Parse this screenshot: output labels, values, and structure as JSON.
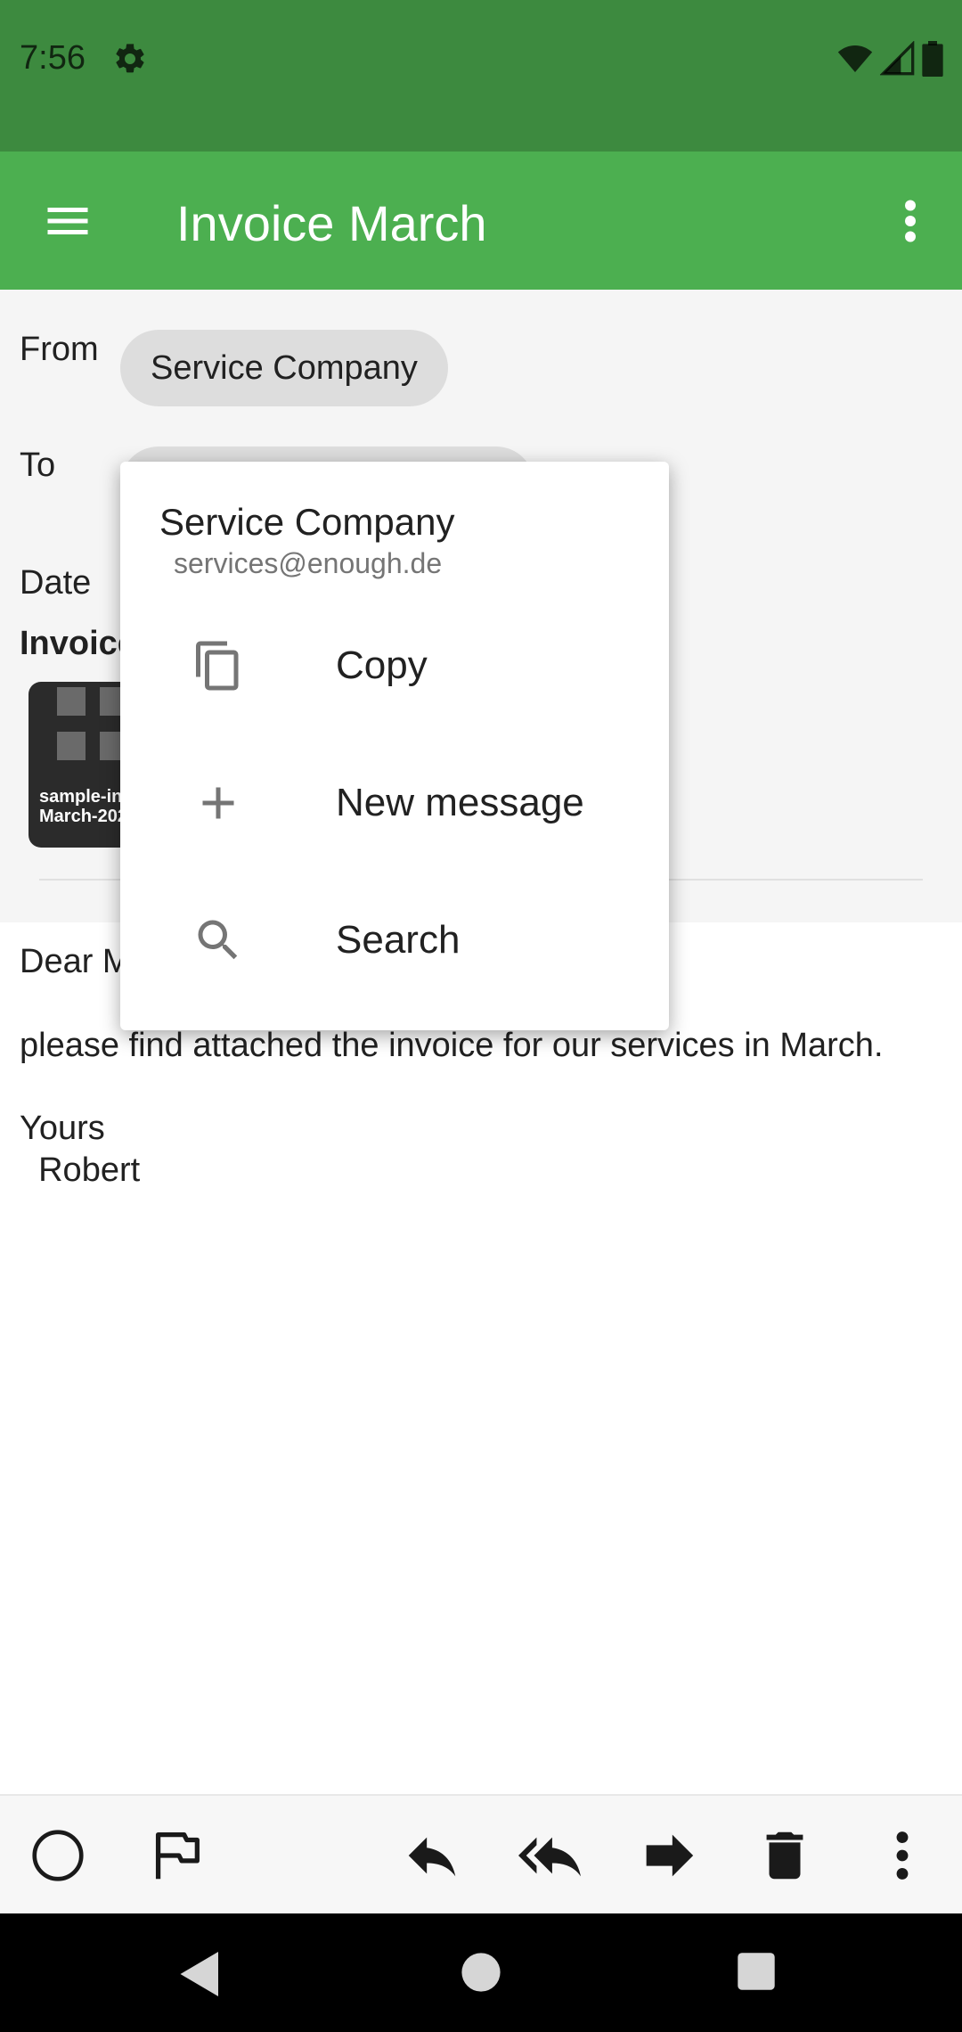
{
  "status_bar": {
    "time": "7:56"
  },
  "app_bar": {
    "title": "Invoice March"
  },
  "header": {
    "from_label": "From",
    "from_chip": "Service Company",
    "to_label": "To",
    "date_label": "Date",
    "subject": "Invoice March",
    "attachment": {
      "name_line1": "sample-invoice-",
      "name_line2": "March-2020.pdf"
    }
  },
  "body": {
    "greeting": "Dear Mr. Smith,",
    "line1": "please find attached the invoice for our services in March.",
    "closing": "Yours",
    "signature": "  Robert"
  },
  "popup": {
    "name": "Service Company",
    "email": "services@enough.de",
    "items": [
      {
        "label": "Copy",
        "icon": "copy-icon"
      },
      {
        "label": "New message",
        "icon": "plus-icon"
      },
      {
        "label": "Search",
        "icon": "search-icon"
      }
    ]
  },
  "bottom_bar": {
    "icons": [
      "unread-circle-icon",
      "flag-icon",
      "reply-icon",
      "reply-all-icon",
      "forward-icon",
      "delete-icon",
      "more-vert-icon"
    ]
  },
  "colors": {
    "status_bar": "#3d8a3f",
    "app_bar": "#4caf50",
    "chip": "#dddddd",
    "popup_bg": "#ffffff"
  }
}
